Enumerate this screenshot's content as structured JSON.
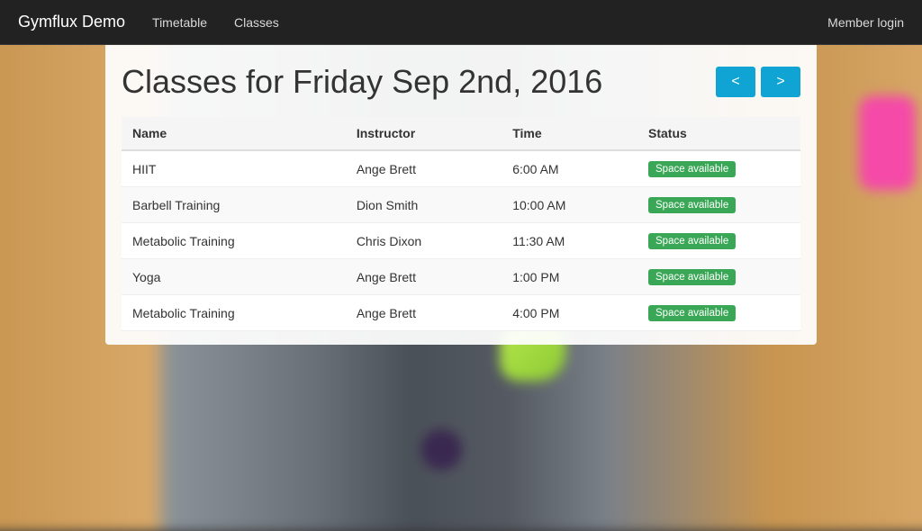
{
  "navbar": {
    "brand": "Gymflux Demo",
    "links": [
      "Timetable",
      "Classes"
    ],
    "login": "Member login"
  },
  "page": {
    "title": "Classes for Friday Sep 2nd, 2016",
    "prev": "<",
    "next": ">"
  },
  "table": {
    "headers": [
      "Name",
      "Instructor",
      "Time",
      "Status"
    ],
    "rows": [
      {
        "name": "HIIT",
        "instructor": "Ange Brett",
        "time": "6:00 AM",
        "status": "Space available"
      },
      {
        "name": "Barbell Training",
        "instructor": "Dion Smith",
        "time": "10:00 AM",
        "status": "Space available"
      },
      {
        "name": "Metabolic Training",
        "instructor": "Chris Dixon",
        "time": "11:30 AM",
        "status": "Space available"
      },
      {
        "name": "Yoga",
        "instructor": "Ange Brett",
        "time": "1:00 PM",
        "status": "Space available"
      },
      {
        "name": "Metabolic Training",
        "instructor": "Ange Brett",
        "time": "4:00 PM",
        "status": "Space available"
      }
    ]
  }
}
